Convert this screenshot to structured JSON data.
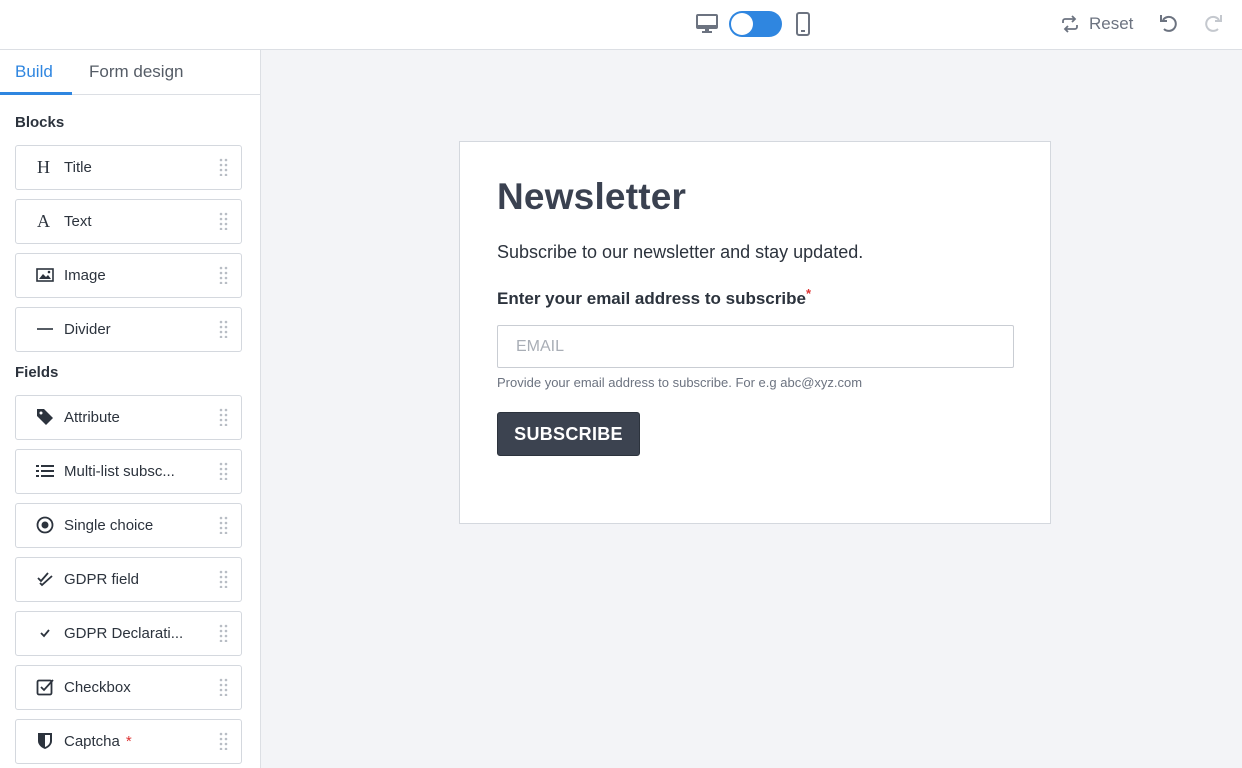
{
  "header": {
    "desktop_icon": "desktop-monitor-icon",
    "mobile_icon": "mobile-phone-icon",
    "view_toggle_state": "desktop",
    "reset_label": "Reset",
    "undo_icon": "undo-icon",
    "redo_icon": "redo-icon"
  },
  "sidebar": {
    "tabs": [
      {
        "label": "Build",
        "active": true
      },
      {
        "label": "Form design",
        "active": false
      }
    ],
    "blocks_heading": "Blocks",
    "blocks": [
      {
        "label": "Title",
        "icon": "heading-icon"
      },
      {
        "label": "Text",
        "icon": "text-icon"
      },
      {
        "label": "Image",
        "icon": "image-icon"
      },
      {
        "label": "Divider",
        "icon": "divider-icon"
      }
    ],
    "fields_heading": "Fields",
    "fields": [
      {
        "label": "Attribute",
        "icon": "tag-icon"
      },
      {
        "label": "Multi-list subsc...",
        "icon": "list-icon"
      },
      {
        "label": "Single choice",
        "icon": "radio-icon"
      },
      {
        "label": "GDPR field",
        "icon": "double-check-icon"
      },
      {
        "label": "GDPR Declarati...",
        "icon": "check-icon"
      },
      {
        "label": "Checkbox",
        "icon": "checkbox-icon"
      },
      {
        "label": "Captcha",
        "icon": "shield-icon",
        "required_mark": "*"
      }
    ]
  },
  "form": {
    "title": "Newsletter",
    "description": "Subscribe to our newsletter and stay updated.",
    "email_label": "Enter your email address to subscribe",
    "required_mark": "*",
    "email_placeholder": "EMAIL",
    "email_value": "",
    "help_text": "Provide your email address to subscribe. For e.g abc@xyz.com",
    "button_label": "SUBSCRIBE"
  },
  "colors": {
    "accent": "#2f86e0",
    "button_bg": "#3c4350",
    "required": "#d33333",
    "canvas_bg": "#f3f4f7"
  }
}
